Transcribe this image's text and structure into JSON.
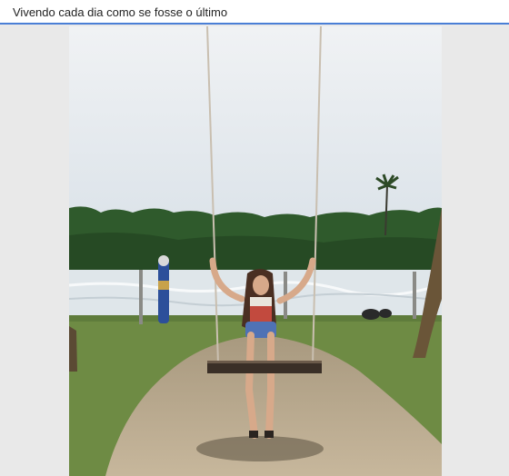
{
  "window": {
    "title": "Vivendo cada dia como se fosse o último"
  },
  "photo": {
    "subject-icon": "photo-content",
    "colors": {
      "sky": "#e6ebf0",
      "trees": "#2f5a2c",
      "water": "#dfe6ea",
      "grass": "#6e8b44",
      "sand": "#b9a88e",
      "viewer_bg": "#e9e9e9",
      "accent": "#4a7fd6"
    }
  }
}
